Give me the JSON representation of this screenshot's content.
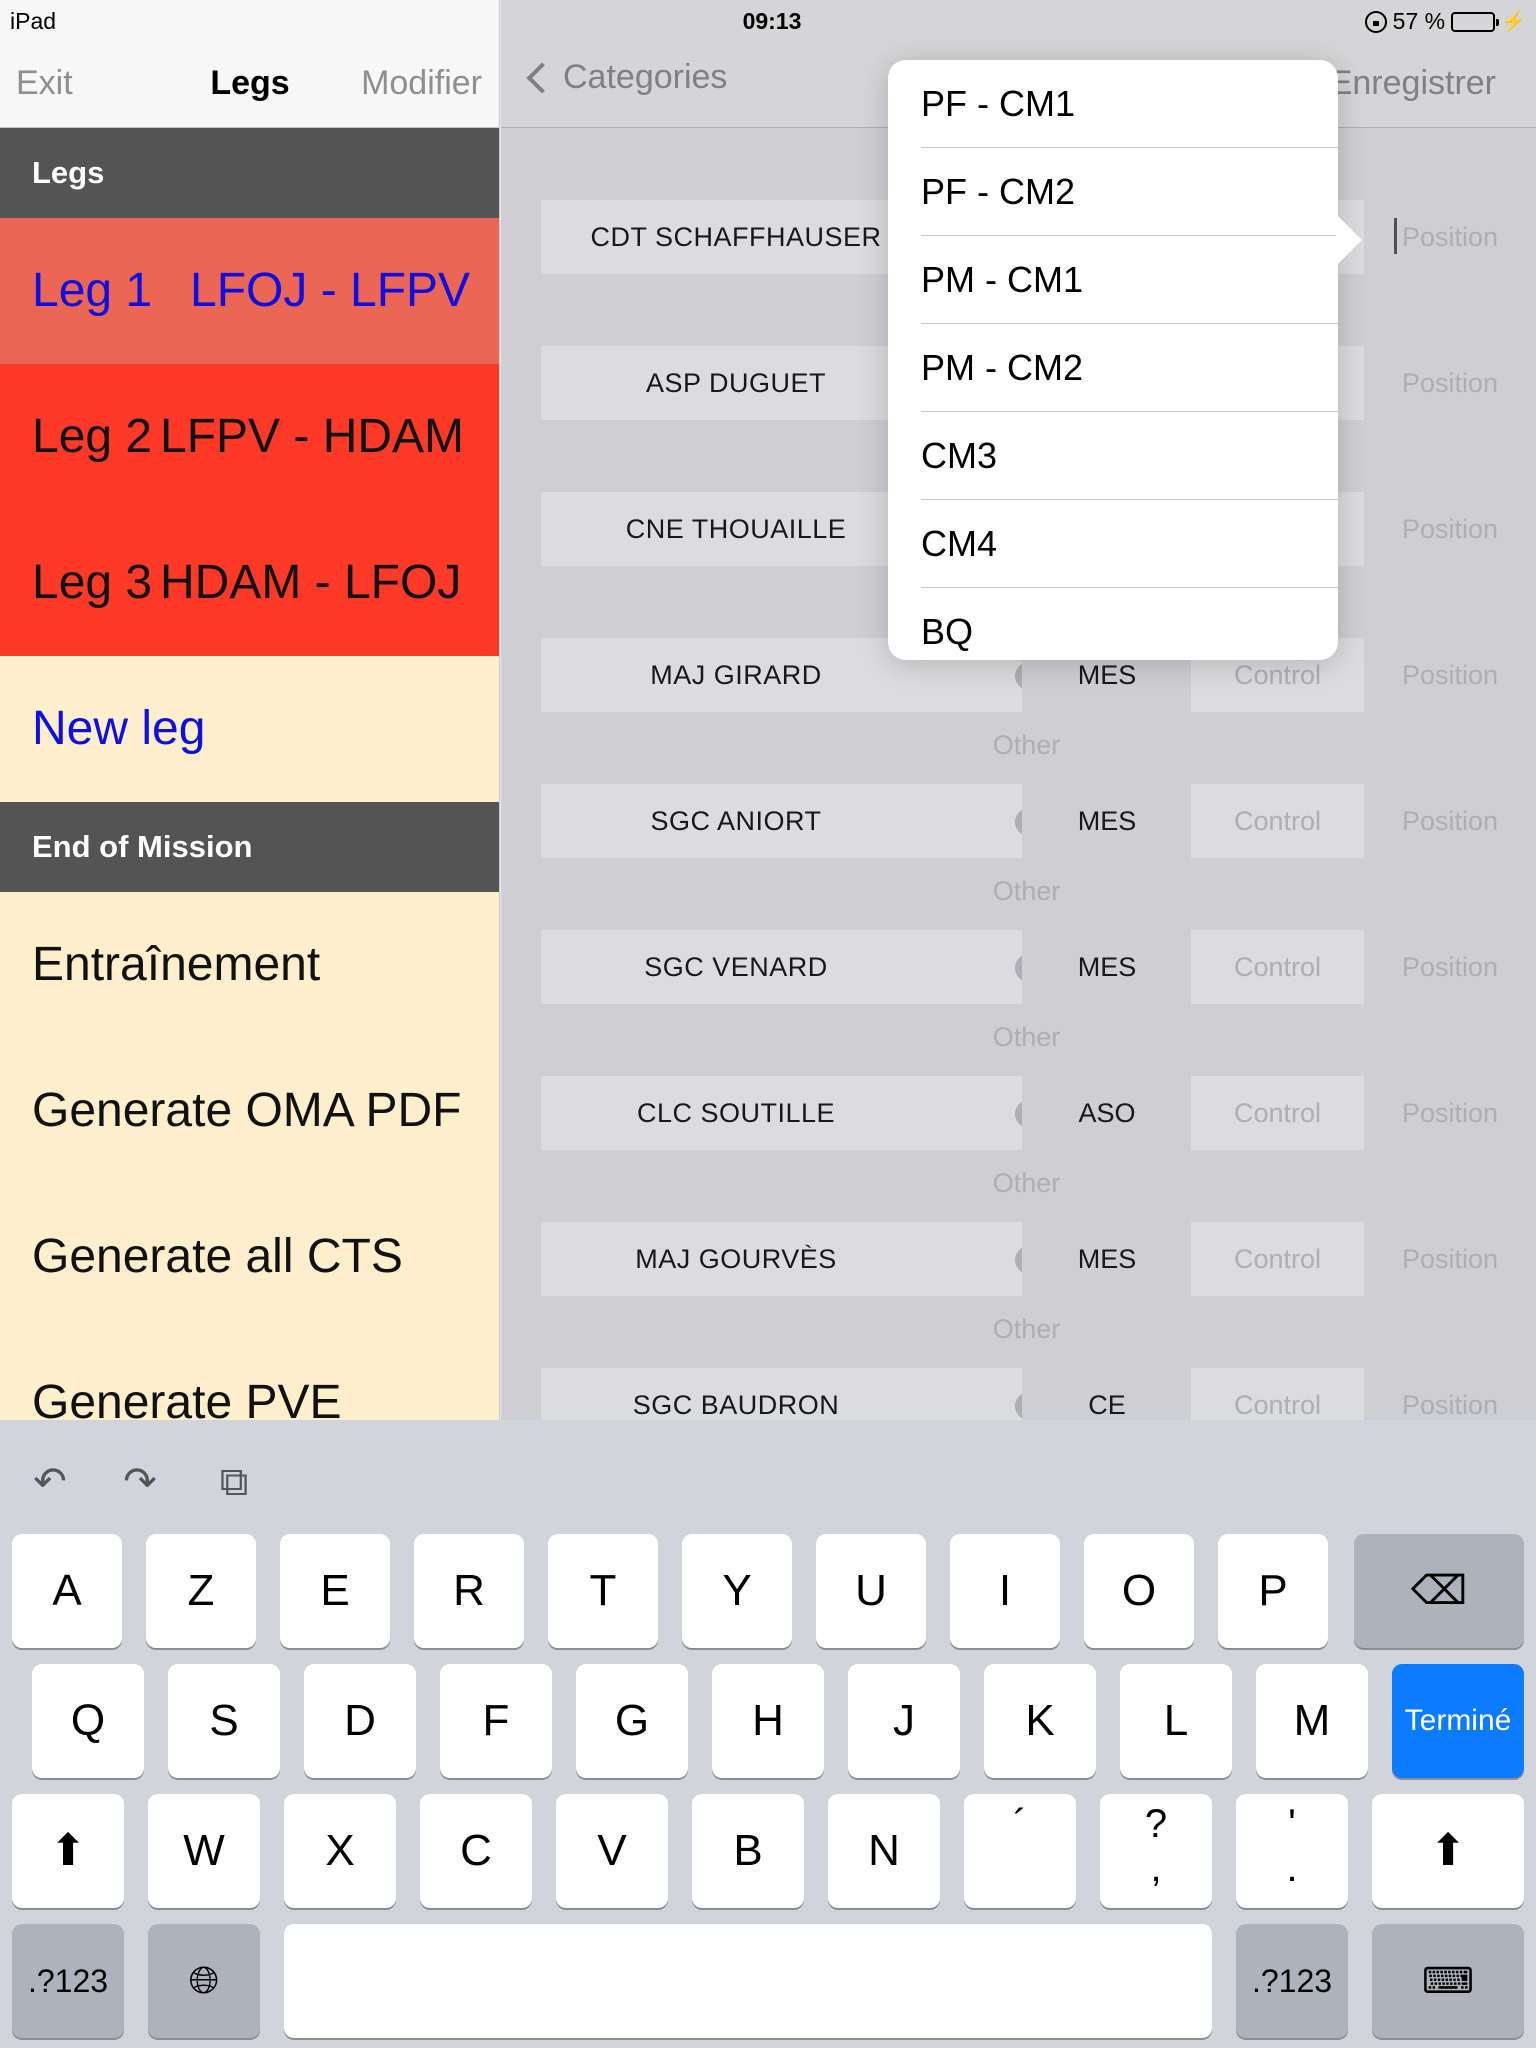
{
  "status_bar": {
    "device": "iPad",
    "time": "09:13",
    "battery": "57 %",
    "battery_level": 0.57
  },
  "master": {
    "nav": {
      "left": "Exit",
      "title": "Legs",
      "right": "Modifier"
    },
    "sections": [
      {
        "header": "Legs"
      },
      {
        "header": "End of Mission"
      }
    ],
    "legs": [
      {
        "name": "Leg 1",
        "route": "LFOJ - LFPV",
        "selected": true
      },
      {
        "name": "Leg 2",
        "route": "LFPV - HDAM",
        "selected": false
      },
      {
        "name": "Leg 3",
        "route": "HDAM - LFOJ",
        "selected": false
      }
    ],
    "new_leg": "New leg",
    "actions": [
      "Entraînement",
      "Generate OMA PDF",
      "Generate all CTS",
      "Generate PVE"
    ]
  },
  "detail": {
    "nav": {
      "back": "Categories",
      "save": "Enregistrer"
    },
    "placeholders": {
      "control": "Control",
      "position": "Position",
      "other": "Other"
    },
    "crew": [
      {
        "name": "CDT SCHAFFHAUSER",
        "category": ""
      },
      {
        "name": "ASP DUGUET",
        "category": ""
      },
      {
        "name": "CNE THOUAILLE",
        "category": ""
      },
      {
        "name": "MAJ GIRARD",
        "category": "MES"
      },
      {
        "name": "SGC ANIORT",
        "category": "MES"
      },
      {
        "name": "SGC VENARD",
        "category": "MES"
      },
      {
        "name": "CLC SOUTILLE",
        "category": "ASO"
      },
      {
        "name": "MAJ GOURVÈS",
        "category": "MES"
      },
      {
        "name": "SGC BAUDRON",
        "category": "CE"
      }
    ]
  },
  "popover": {
    "options": [
      "PF - CM1",
      "PF - CM2",
      "PM - CM1",
      "PM - CM2",
      "CM3",
      "CM4",
      "BQ"
    ]
  },
  "keyboard": {
    "toolbar": [
      "undo-icon",
      "redo-icon",
      "paste-icon"
    ],
    "row1": [
      "A",
      "Z",
      "E",
      "R",
      "T",
      "Y",
      "U",
      "I",
      "O",
      "P"
    ],
    "row2": [
      "Q",
      "S",
      "D",
      "F",
      "G",
      "H",
      "J",
      "K",
      "L",
      "M"
    ],
    "row3": [
      "W",
      "X",
      "C",
      "V",
      "B",
      "N"
    ],
    "punct": [
      {
        "top": "´",
        "bottom": ""
      },
      {
        "top": "?",
        "bottom": ","
      },
      {
        "top": "'",
        "bottom": "."
      }
    ],
    "done": "Terminé",
    "numbers": ".?123"
  }
}
